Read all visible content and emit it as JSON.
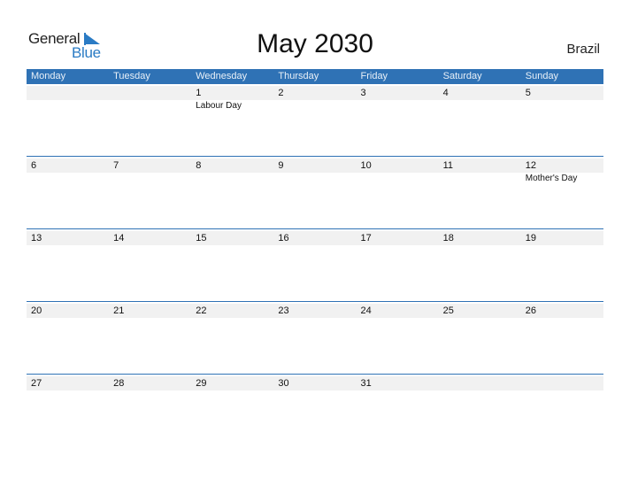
{
  "logo": {
    "line1": "General",
    "line2": "Blue"
  },
  "title": "May 2030",
  "country": "Brazil",
  "colors": {
    "accent": "#2f72b5",
    "band": "#f1f1f1",
    "logo_blue": "#2a7bc4"
  },
  "weekdays": [
    "Monday",
    "Tuesday",
    "Wednesday",
    "Thursday",
    "Friday",
    "Saturday",
    "Sunday"
  ],
  "weeks": [
    [
      {
        "day": ""
      },
      {
        "day": ""
      },
      {
        "day": "1",
        "holiday": "Labour Day"
      },
      {
        "day": "2"
      },
      {
        "day": "3"
      },
      {
        "day": "4"
      },
      {
        "day": "5"
      }
    ],
    [
      {
        "day": "6"
      },
      {
        "day": "7"
      },
      {
        "day": "8"
      },
      {
        "day": "9"
      },
      {
        "day": "10"
      },
      {
        "day": "11"
      },
      {
        "day": "12",
        "holiday": "Mother's Day"
      }
    ],
    [
      {
        "day": "13"
      },
      {
        "day": "14"
      },
      {
        "day": "15"
      },
      {
        "day": "16"
      },
      {
        "day": "17"
      },
      {
        "day": "18"
      },
      {
        "day": "19"
      }
    ],
    [
      {
        "day": "20"
      },
      {
        "day": "21"
      },
      {
        "day": "22"
      },
      {
        "day": "23"
      },
      {
        "day": "24"
      },
      {
        "day": "25"
      },
      {
        "day": "26"
      }
    ],
    [
      {
        "day": "27"
      },
      {
        "day": "28"
      },
      {
        "day": "29"
      },
      {
        "day": "30"
      },
      {
        "day": "31"
      },
      {
        "day": ""
      },
      {
        "day": ""
      }
    ]
  ]
}
